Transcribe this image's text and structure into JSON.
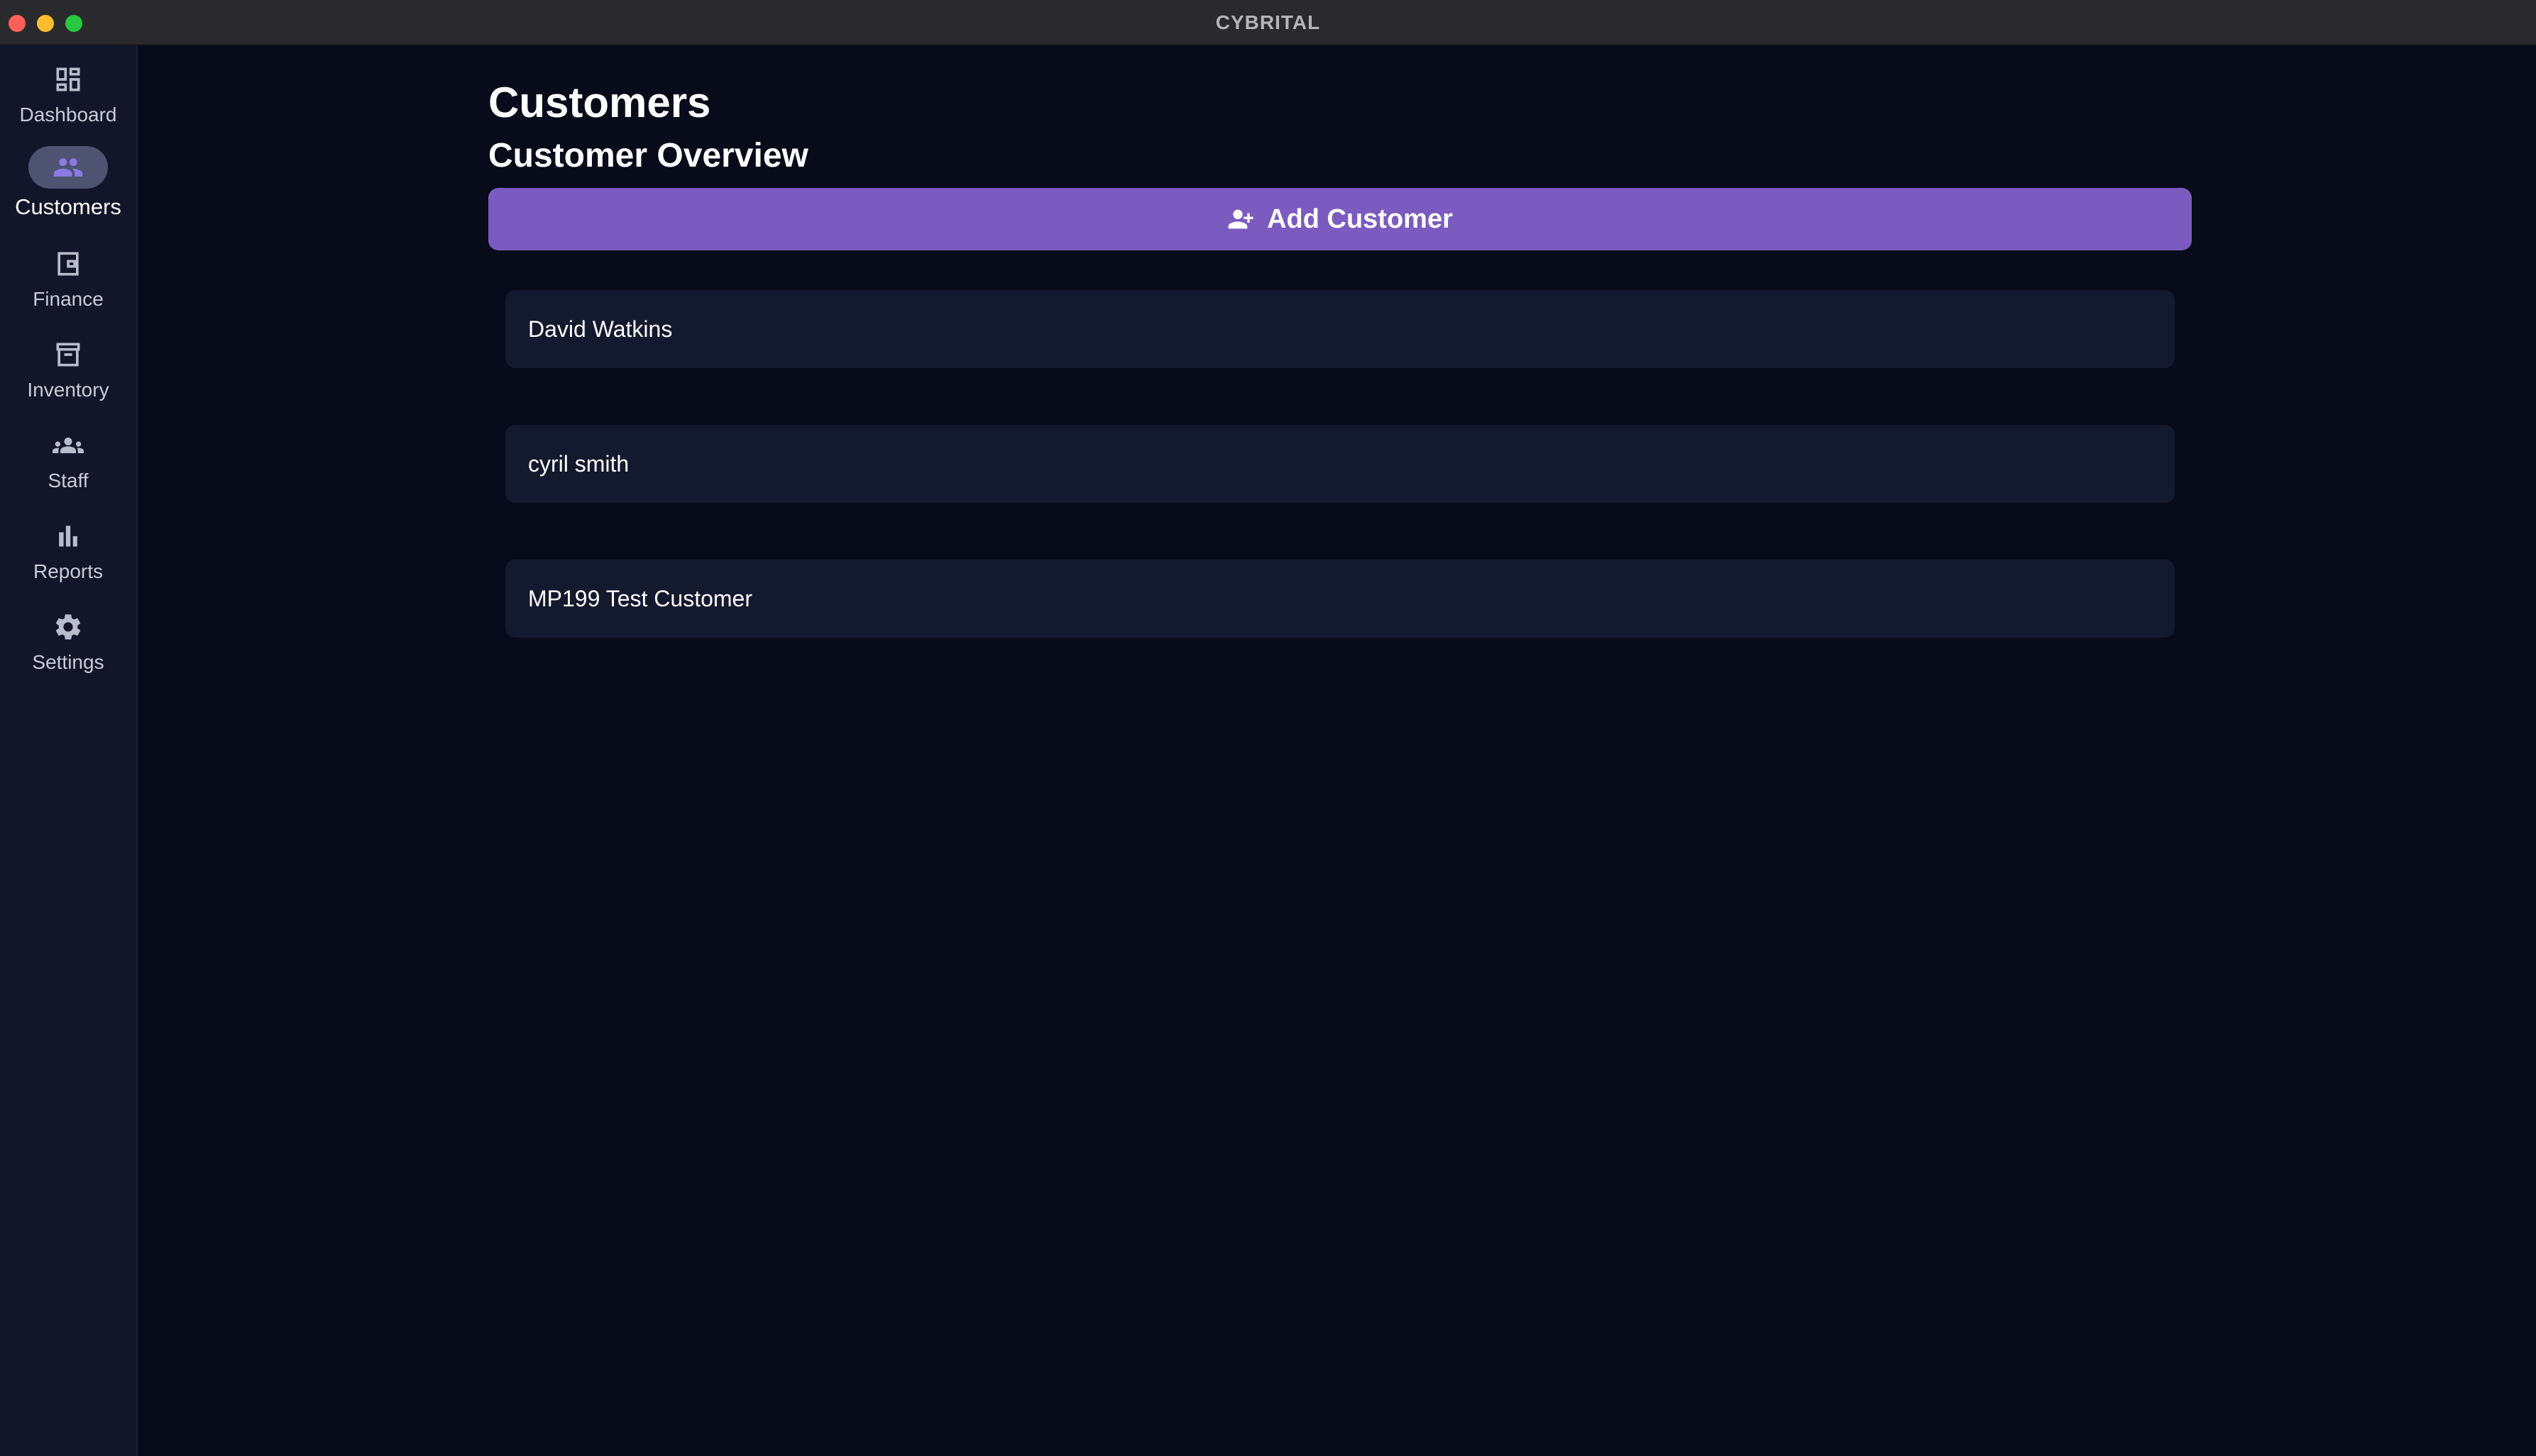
{
  "window": {
    "title": "CYBRITAL"
  },
  "sidebar": {
    "items": [
      {
        "label": "Dashboard",
        "icon": "dashboard-icon",
        "active": false
      },
      {
        "label": "Customers",
        "icon": "customers-icon",
        "active": true
      },
      {
        "label": "Finance",
        "icon": "wallet-icon",
        "active": false
      },
      {
        "label": "Inventory",
        "icon": "archive-icon",
        "active": false
      },
      {
        "label": "Staff",
        "icon": "groups-icon",
        "active": false
      },
      {
        "label": "Reports",
        "icon": "bar-chart-icon",
        "active": false
      },
      {
        "label": "Settings",
        "icon": "gear-icon",
        "active": false
      }
    ]
  },
  "main": {
    "title": "Customers",
    "section_title": "Customer Overview",
    "add_button_label": "Add Customer",
    "customers": [
      {
        "name": "David Watkins"
      },
      {
        "name": "cyril smith"
      },
      {
        "name": "MP199 Test Customer"
      }
    ]
  },
  "colors": {
    "background": "#080b1a",
    "sidebar": "#111629",
    "accent": "#7b5bbf",
    "row": "#131a2e",
    "active_icon": "#8c7ae6"
  }
}
